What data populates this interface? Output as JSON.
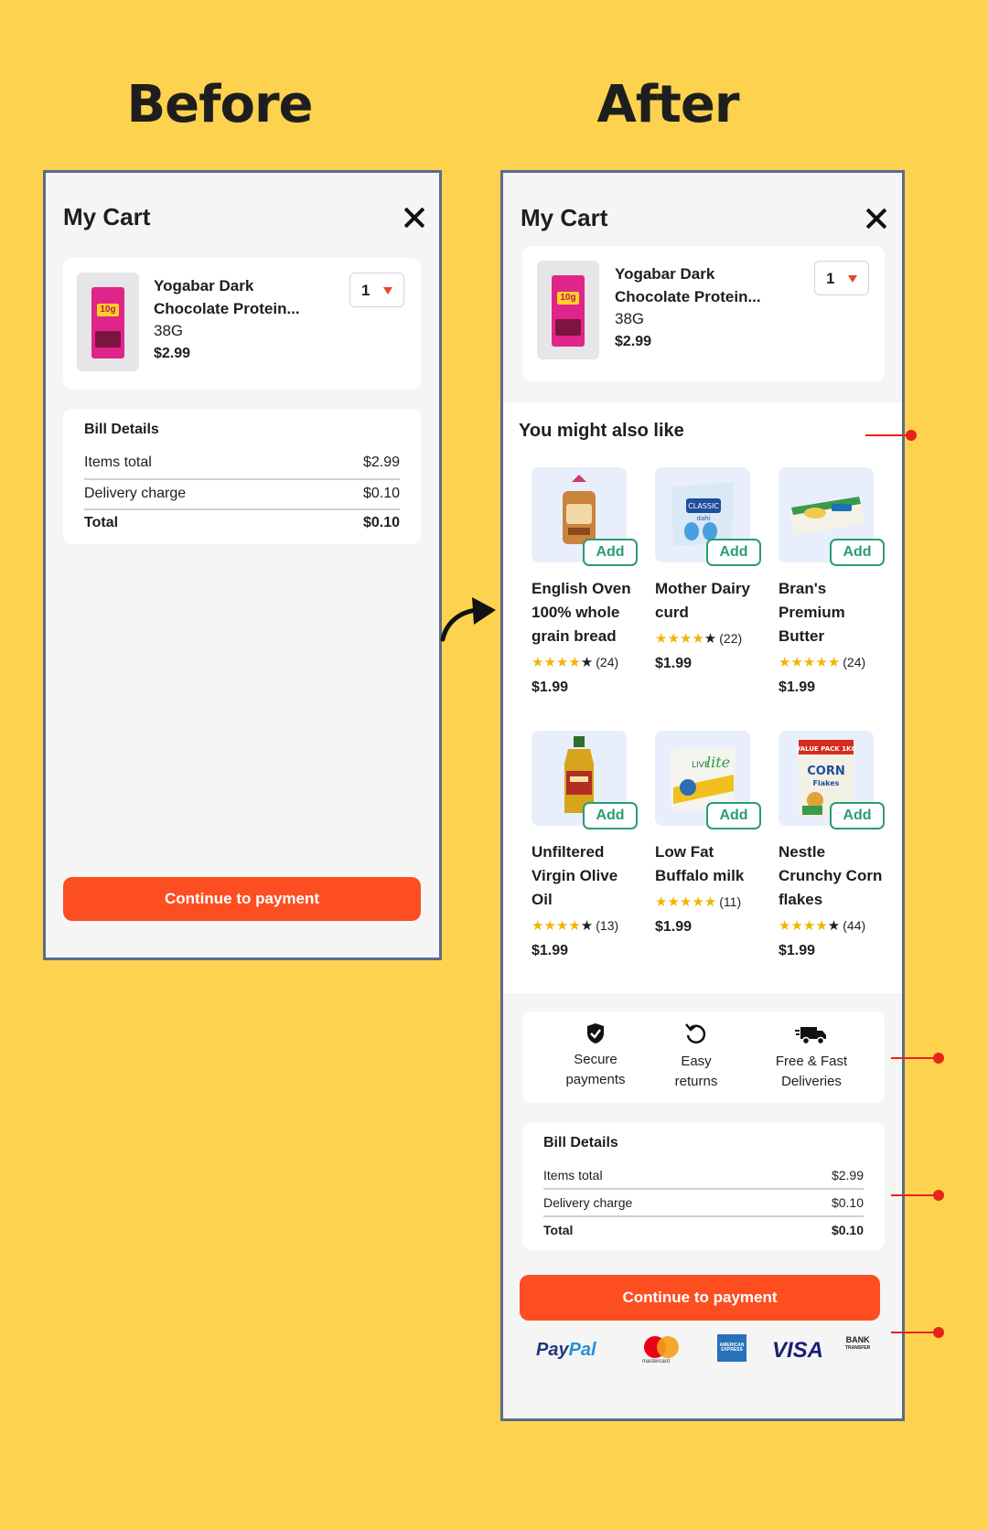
{
  "headings": {
    "before": "Before",
    "after": "After"
  },
  "cart": {
    "title": "My Cart",
    "product": {
      "name": "Yogabar Dark Chocolate Protein...",
      "name_line1": "Yogabar Dark",
      "name_line2": "Chocolate Protein...",
      "weight": "38G",
      "price": "$2.99",
      "pack_label": "10g",
      "quantity": "1"
    }
  },
  "bill": {
    "title": "Bill Details",
    "rows": [
      {
        "label": "Items total",
        "value": "$2.99"
      },
      {
        "label": "Delivery charge",
        "value": "$0.10"
      },
      {
        "label": "Total",
        "value": "$0.10"
      }
    ]
  },
  "continue_label": "Continue to payment",
  "recommendations": {
    "title": "You might also like",
    "add_label": "Add",
    "items": [
      {
        "name": "English Oven 100% whole grain bread",
        "rating": 4,
        "reviews": "(24)",
        "price": "$1.99"
      },
      {
        "name": "Mother Dairy curd",
        "rating": 4.5,
        "reviews": "(22)",
        "price": "$1.99"
      },
      {
        "name": "Bran's Premium Butter",
        "rating": 5,
        "reviews": "(24)",
        "price": "$1.99"
      },
      {
        "name": "Unfiltered Virgin Olive Oil",
        "rating": 4.5,
        "reviews": "(13)",
        "price": "$1.99"
      },
      {
        "name": "Low Fat Buffalo milk",
        "rating": 5,
        "reviews": "(11)",
        "price": "$1.99"
      },
      {
        "name": "Nestle Crunchy Corn flakes",
        "rating": 4.5,
        "reviews": "(44)",
        "price": "$1.99"
      }
    ]
  },
  "trust": [
    {
      "icon": "shield-check-icon",
      "label_1": "Secure",
      "label_2": "payments"
    },
    {
      "icon": "refresh-icon",
      "label_1": "Easy",
      "label_2": "returns"
    },
    {
      "icon": "truck-icon",
      "label_1": "Free & Fast",
      "label_2": "Deliveries"
    }
  ],
  "payment_logos": {
    "paypal_1": "Pay",
    "paypal_2": "Pal",
    "mastercard": "mastercard",
    "amex": "AMERICAN EXPRESS",
    "visa": "VISA",
    "bank_1": "BANK",
    "bank_2": "TRANSFER"
  },
  "product_art": {
    "curd_line1": "CLASSIC",
    "curd_line2": "dahi",
    "milk_line1": "LIVE",
    "milk_line2": "lite",
    "cereal_line1": "VALUE PACK 1KG",
    "cereal_line2": "CORN",
    "cereal_line3": "Flakes"
  },
  "colors": {
    "background": "#FDD24F",
    "accent": "#FD4E22",
    "add_green": "#2a9d72",
    "star": "#f4b400",
    "marker": "#e8231a"
  }
}
